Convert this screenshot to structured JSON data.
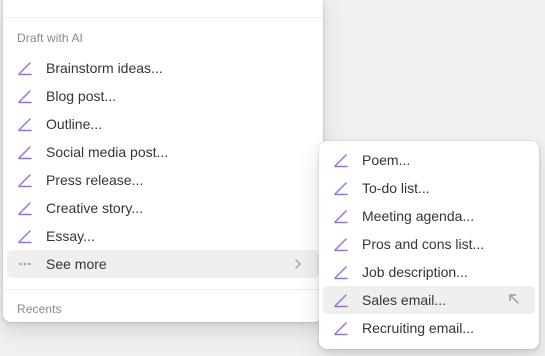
{
  "main_menu": {
    "section_title": "Draft with AI",
    "items": [
      {
        "label": "Brainstorm ideas...",
        "icon": "pencil-line-icon"
      },
      {
        "label": "Blog post...",
        "icon": "pencil-line-icon"
      },
      {
        "label": "Outline...",
        "icon": "pencil-line-icon"
      },
      {
        "label": "Social media post...",
        "icon": "pencil-line-icon"
      },
      {
        "label": "Press release...",
        "icon": "pencil-line-icon"
      },
      {
        "label": "Creative story...",
        "icon": "pencil-line-icon"
      },
      {
        "label": "Essay...",
        "icon": "pencil-line-icon"
      }
    ],
    "see_more": {
      "label": "See more",
      "icon": "more-dots-icon",
      "arrow": "chevron-right-icon"
    },
    "recents_title": "Recents"
  },
  "sub_menu": {
    "items": [
      {
        "label": "Poem...",
        "icon": "pencil-line-icon"
      },
      {
        "label": "To-do list...",
        "icon": "pencil-line-icon"
      },
      {
        "label": "Meeting agenda...",
        "icon": "pencil-line-icon"
      },
      {
        "label": "Pros and cons list...",
        "icon": "pencil-line-icon"
      },
      {
        "label": "Job description...",
        "icon": "pencil-line-icon"
      },
      {
        "label": "Sales email...",
        "icon": "pencil-line-icon"
      },
      {
        "label": "Recruiting email...",
        "icon": "pencil-line-icon"
      }
    ],
    "hovered_item": "Sales email..."
  },
  "colors": {
    "ai_accent": "#9a6dd7",
    "text": "#37352f",
    "muted": "#8a8985",
    "hover_bg": "#efefee"
  }
}
